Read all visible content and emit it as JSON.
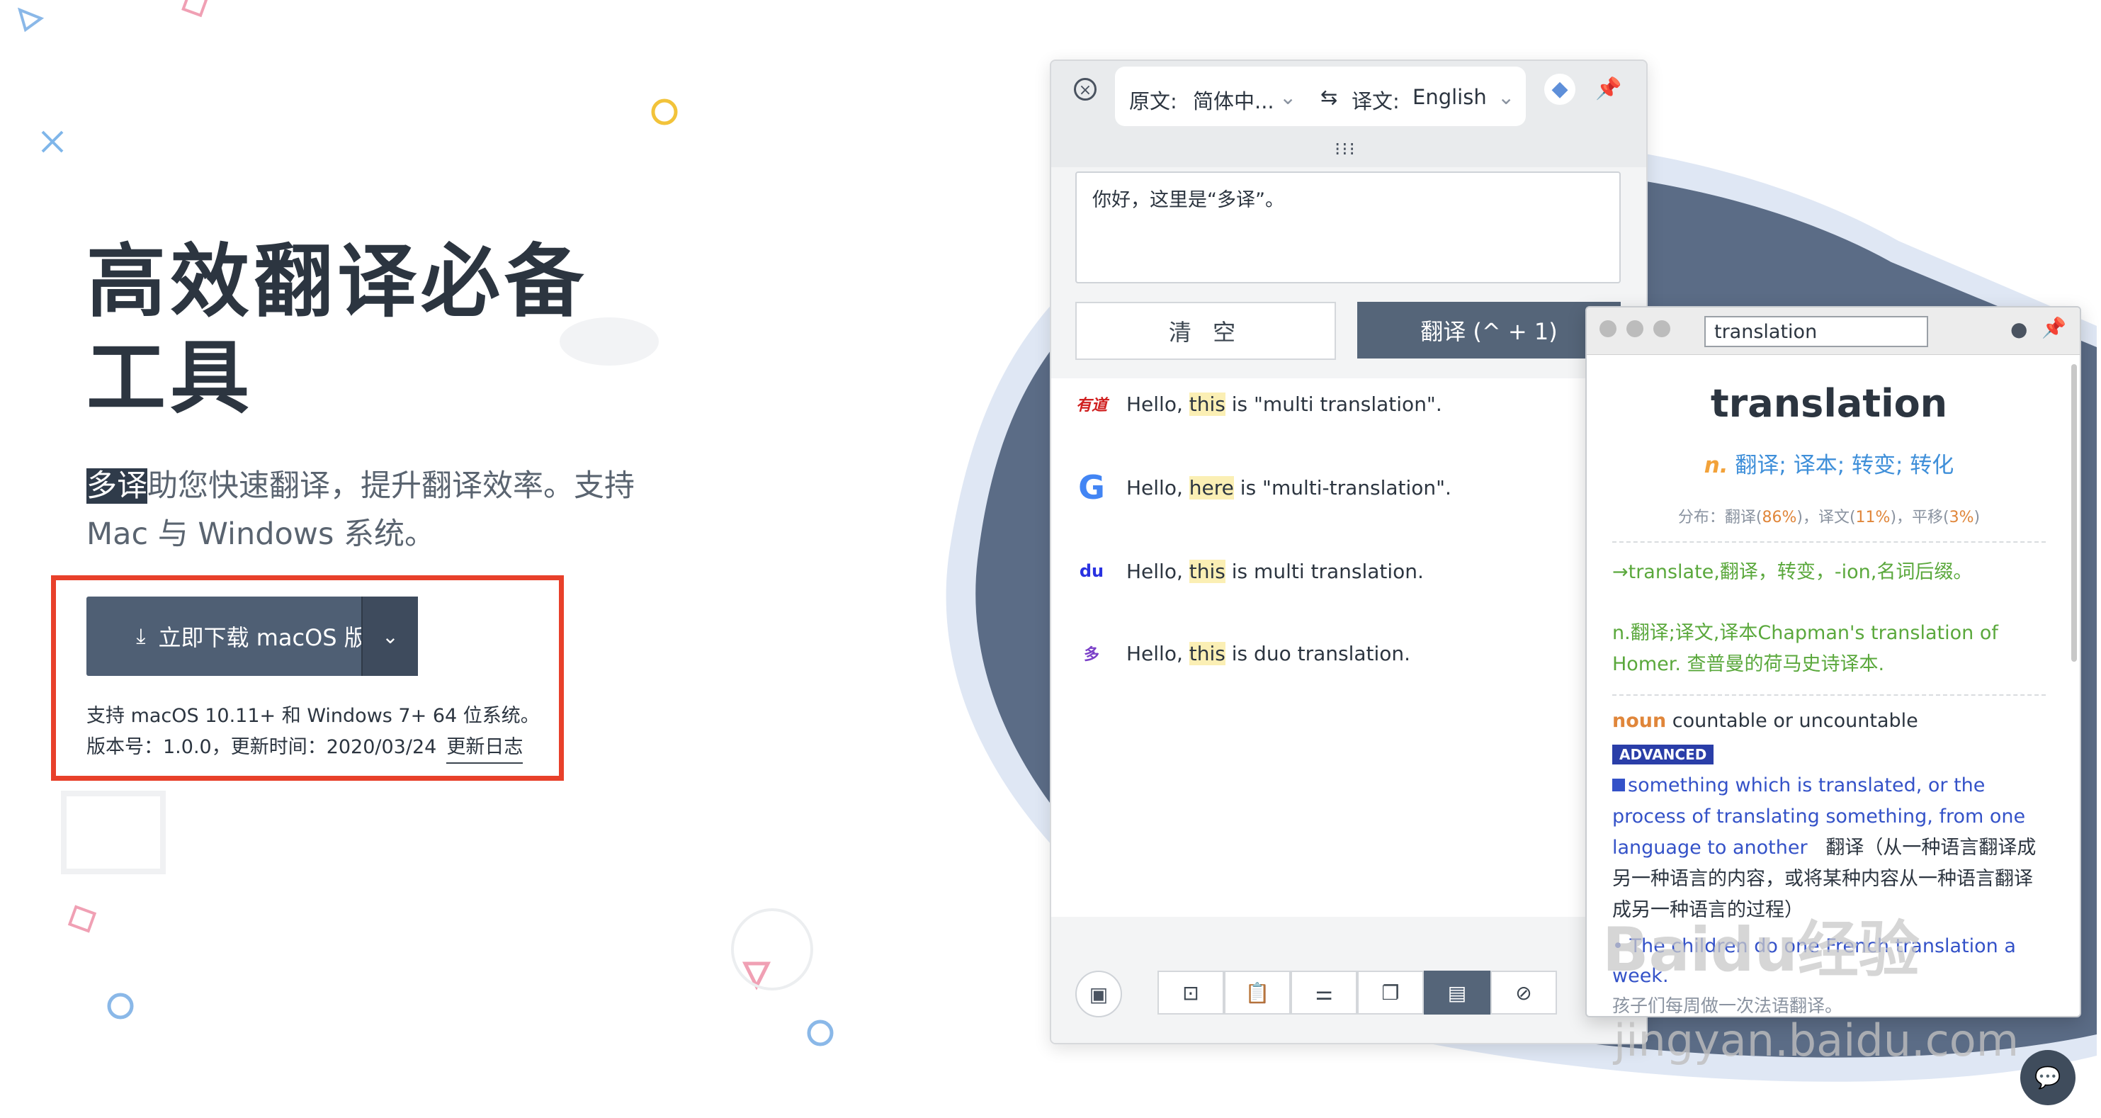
{
  "hero": {
    "title": "高效翻译必备工具",
    "subtitle_highlight": "多译",
    "subtitle_rest": "助您快速翻译，提升翻译效率。支持 Mac 与 Windows 系统。",
    "download_label": "立即下载 macOS 版",
    "download_icon": "download-icon",
    "dropdown_icon": "chevron-down-icon",
    "system_req": "支持 macOS 10.11+ 和 Windows 7+ 64 位系统。",
    "version_text": "版本号：1.0.0，更新时间：2020/03/24",
    "changelog_link": "更新日志"
  },
  "translator": {
    "source_label": "原文:",
    "source_lang": "简体中...",
    "swap_icon": "swap-icon",
    "target_label": "译文:",
    "target_lang": "English",
    "source_text": "你好，这里是“多译”。",
    "clear_label": "清 空",
    "translate_label": "翻译 (^ + 1)",
    "results": [
      {
        "engine": "有道",
        "pre": "Hello, ",
        "hl": "this",
        "post": " is \"multi translation\"."
      },
      {
        "engine": "G",
        "pre": "Hello, ",
        "hl": "here",
        "post": " is \"multi-translation\"."
      },
      {
        "engine": "du",
        "pre": "Hello, ",
        "hl": "this",
        "post": " is multi translation."
      },
      {
        "engine": "多",
        "pre": "Hello, ",
        "hl": "this",
        "post": " is duo translation."
      }
    ]
  },
  "dictionary": {
    "query": "translation",
    "word": "translation",
    "pos": "n.",
    "zh_meanings": "翻译; 译本; 转变; 转化",
    "dist_prefix": "分布：翻译(",
    "dist_a": "86%",
    "dist_mid1": ")，译文(",
    "dist_b": "11%",
    "dist_mid2": ")，平移(",
    "dist_c": "3%",
    "dist_suffix": ")",
    "derive": "→translate,翻译，转变，-ion,名词后缀。",
    "example_zh": "n.翻译;译文,译本Chapman's translation of Homer. 查普曼的荷马史诗译本.",
    "noun_label": "noun",
    "noun_rest": " countable or uncountable",
    "level_badge": "ADVANCED",
    "def_en": "something which is translated, or the process of translating something, from one language to another",
    "def_zh": "翻译（从一种语言翻译成另一种语言的内容，或将某种内容从一种语言翻译成另一种语言的过程）",
    "example_en": "• The children do one French translation a week.",
    "example_cn": "孩子们每周做一次法语翻译。"
  },
  "watermark": {
    "brand": "Baidu经验",
    "url": "jingyan.baidu.com"
  },
  "colors": {
    "accent": "#556579",
    "highlight_box": "#e8402a",
    "blob": "#5b6c86",
    "link_blue": "#3452c8",
    "green": "#5aa83c"
  }
}
